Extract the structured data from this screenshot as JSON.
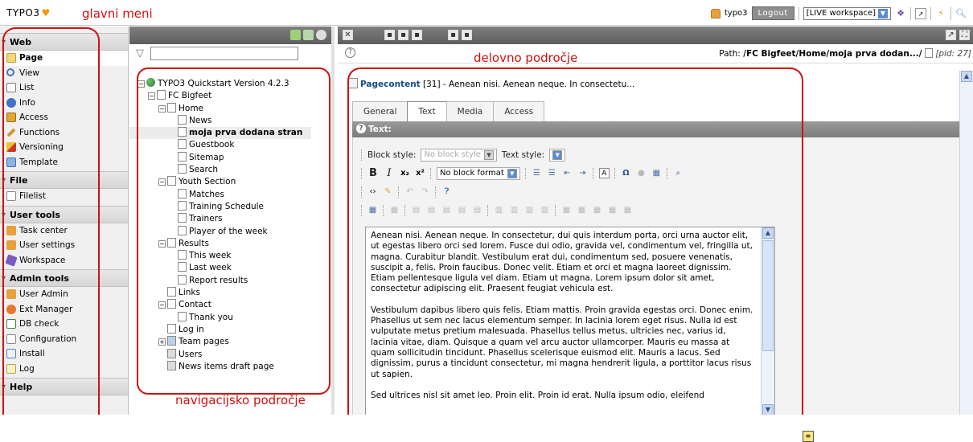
{
  "app": {
    "logo_text": "TYPO3"
  },
  "annotations": {
    "main_menu": "glavni meni",
    "work_area": "delovno področje",
    "nav_area": "navigacijsko področje"
  },
  "topbar": {
    "username": "typo3",
    "logout_label": "Logout",
    "workspace_value": "[LIVE workspace]"
  },
  "module_menu": {
    "groups": [
      {
        "label": "Web",
        "items": [
          "Page",
          "View",
          "List",
          "Info",
          "Access",
          "Functions",
          "Versioning",
          "Template"
        ]
      },
      {
        "label": "File",
        "items": [
          "Filelist"
        ]
      },
      {
        "label": "User tools",
        "items": [
          "Task center",
          "User settings",
          "Workspace"
        ]
      },
      {
        "label": "Admin tools",
        "items": [
          "User Admin",
          "Ext Manager",
          "DB check",
          "Configuration",
          "Install",
          "Log"
        ]
      },
      {
        "label": "Help",
        "items": []
      }
    ],
    "active_item": "Page"
  },
  "page_tree": {
    "root": "TYPO3 Quickstart Version 4.2.3",
    "nodes": [
      "FC Bigfeet",
      "Home",
      "News",
      "moja prva dodana stran",
      "Guestbook",
      "Sitemap",
      "Search",
      "Youth Section",
      "Matches",
      "Training Schedule",
      "Trainers",
      "Player of the week",
      "Results",
      "This week",
      "Last week",
      "Report results",
      "Links",
      "Contact",
      "Thank you",
      "Log in",
      "Team pages",
      "Users",
      "News items draft page"
    ]
  },
  "content": {
    "path_label": "Path: ",
    "path_value": "/FC Bigfeet/Home/moja prva dodan.../",
    "pid": "[pid: 27]",
    "pagecontent_label": "Pagecontent",
    "pagecontent_rest": " [31] - Aenean nisi. Aenean neque. In consectetu...",
    "tabs": [
      "General",
      "Text",
      "Media",
      "Access"
    ],
    "active_tab": "Text",
    "section_label": "Text:",
    "block_style_label": "Block style:",
    "block_style_value": "No block style",
    "text_style_label": "Text style:",
    "block_format_value": "No block format",
    "paragraphs": [
      "Aenean nisi. Aenean neque. In consectetur, dui quis interdum porta, orci urna auctor elit, ut egestas libero orci sed lorem. Fusce dui odio, gravida vel, condimentum vel, fringilla ut, magna. Curabitur blandit. Vestibulum erat dui, condimentum sed, posuere venenatis, suscipit a, felis. Proin faucibus. Donec velit. Etiam et orci et magna laoreet dignissim. Etiam pellentesque ligula vel diam. Etiam ut magna. Lorem ipsum dolor sit amet, consectetur adipiscing elit. Praesent feugiat vehicula est.",
      "Vestibulum dapibus libero quis felis. Etiam mattis. Proin gravida egestas orci. Donec enim. Phasellus ut sem nec lacus elementum semper. In lacinia lorem eget risus. Nulla id est vulputate metus pretium malesuada. Phasellus tellus metus, ultricies nec, varius id, lacinia vitae, diam. Quisque a quam vel arcu auctor ullamcorper. Mauris eu massa at quam sollicitudin tincidunt. Phasellus scelerisque euismod elit. Mauris a lacus. Sed dignissim, purus a tincidunt consectetur, mi magna hendrerit ligula, a porttitor lacus risus ut sapien.",
      "Sed ultrices nisl sit amet leo. Proin elit. Proin id erat. Nulla ipsum odio, eleifend"
    ]
  }
}
